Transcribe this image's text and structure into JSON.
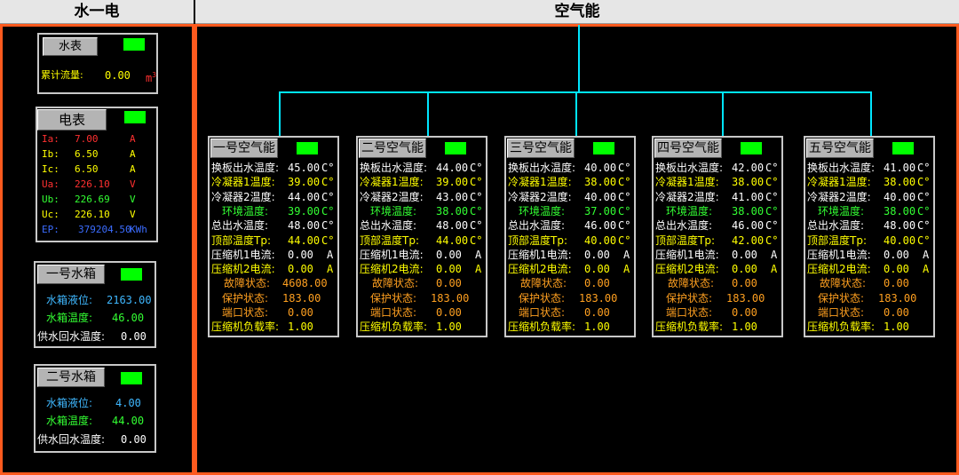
{
  "headers": {
    "left": "水一电",
    "right": "空气能"
  },
  "water_meter": {
    "title": "水表",
    "flow_label": "累计流量:",
    "flow_value": "0.00",
    "flow_unit": "m",
    "flow_unit_sup": "3"
  },
  "elec_meter": {
    "title": "电表",
    "rows": [
      {
        "label": "Ia:",
        "value": "7.00",
        "unit": "A",
        "color": "#ff3030"
      },
      {
        "label": "Ib:",
        "value": "6.50",
        "unit": "A",
        "color": "#ffff00"
      },
      {
        "label": "Ic:",
        "value": "6.50",
        "unit": "A",
        "color": "#ffff00"
      },
      {
        "label": "Ua:",
        "value": "226.10",
        "unit": "V",
        "color": "#ff3030"
      },
      {
        "label": "Ub:",
        "value": "226.69",
        "unit": "V",
        "color": "#33ff33"
      },
      {
        "label": "Uc:",
        "value": "226.10",
        "unit": "V",
        "color": "#ffff00"
      },
      {
        "label": "EP:",
        "value": "379204.50",
        "unit": "KWh",
        "color": "#3b6cff"
      }
    ]
  },
  "tanks": [
    {
      "title": "一号水箱",
      "level_label": "水箱液位:",
      "level_value": "2163.00",
      "temp_label": "水箱温度:",
      "temp_value": "46.00",
      "supply_label": "供水回水温度:",
      "supply_value": "0.00"
    },
    {
      "title": "二号水箱",
      "level_label": "水箱液位:",
      "level_value": "4.00",
      "temp_label": "水箱温度:",
      "temp_value": "44.00",
      "supply_label": "供水回水温度:",
      "supply_value": "0.00"
    }
  ],
  "row_labels": {
    "r1": "换板出水温度:",
    "r2": "冷凝器1温度:",
    "r3": "冷凝器2温度:",
    "r4": "环境温度:",
    "r5": "总出水温度:",
    "r6": "顶部温度Tp:",
    "r7": "压缩机1电流:",
    "r8": "压缩机2电流:",
    "r9": "故障状态:",
    "r10": "保护状态:",
    "r11": "端口状态:",
    "r12": "压缩机负载率:"
  },
  "units": {
    "temp": "C°",
    "amp": "A"
  },
  "heat_pumps": [
    {
      "title": "一号空气能",
      "r1": "45.00",
      "r2": "39.00",
      "r3": "44.00",
      "r4": "39.00",
      "r5": "48.00",
      "r6": "44.00",
      "r7": "0.00",
      "r8": "0.00",
      "r9": "4608.00",
      "r10": "183.00",
      "r11": "0.00",
      "r12": "1.00"
    },
    {
      "title": "二号空气能",
      "r1": "44.00",
      "r2": "39.00",
      "r3": "43.00",
      "r4": "38.00",
      "r5": "48.00",
      "r6": "44.00",
      "r7": "0.00",
      "r8": "0.00",
      "r9": "0.00",
      "r10": "183.00",
      "r11": "0.00",
      "r12": "1.00"
    },
    {
      "title": "三号空气能",
      "r1": "40.00",
      "r2": "38.00",
      "r3": "40.00",
      "r4": "37.00",
      "r5": "46.00",
      "r6": "40.00",
      "r7": "0.00",
      "r8": "0.00",
      "r9": "0.00",
      "r10": "183.00",
      "r11": "0.00",
      "r12": "1.00"
    },
    {
      "title": "四号空气能",
      "r1": "42.00",
      "r2": "38.00",
      "r3": "41.00",
      "r4": "38.00",
      "r5": "46.00",
      "r6": "42.00",
      "r7": "0.00",
      "r8": "0.00",
      "r9": "0.00",
      "r10": "183.00",
      "r11": "0.00",
      "r12": "1.00"
    },
    {
      "title": "五号空气能",
      "r1": "41.00",
      "r2": "38.00",
      "r3": "40.00",
      "r4": "38.00",
      "r5": "48.00",
      "r6": "40.00",
      "r7": "0.00",
      "r8": "0.00",
      "r9": "0.00",
      "r10": "183.00",
      "r11": "0.00",
      "r12": "1.00"
    }
  ]
}
